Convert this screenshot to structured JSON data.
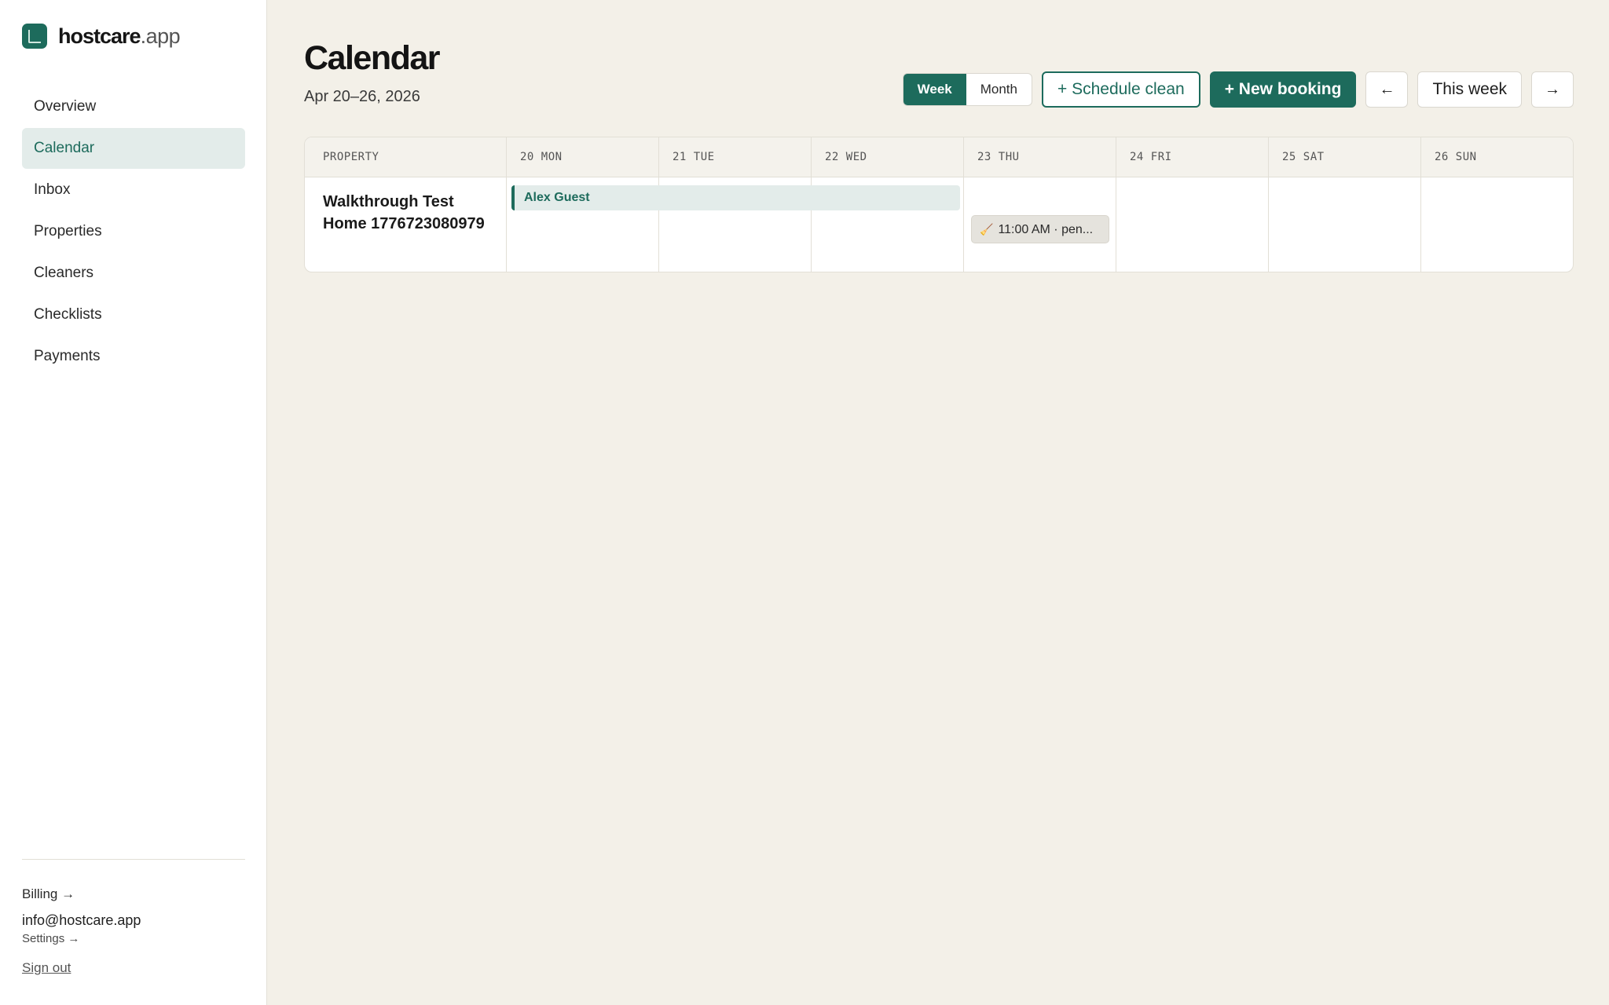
{
  "brand": {
    "name": "hostcare",
    "tld": ".app",
    "logo_icon": "app-logo-icon"
  },
  "nav": [
    {
      "label": "Overview",
      "active": false
    },
    {
      "label": "Calendar",
      "active": true
    },
    {
      "label": "Inbox",
      "active": false
    },
    {
      "label": "Properties",
      "active": false
    },
    {
      "label": "Cleaners",
      "active": false
    },
    {
      "label": "Checklists",
      "active": false
    },
    {
      "label": "Payments",
      "active": false
    }
  ],
  "footer": {
    "billing": "Billing →",
    "email": "info@hostcare.app",
    "settings": "Settings →",
    "signout": "Sign out"
  },
  "header": {
    "title": "Calendar",
    "date_range": "Apr 20–26, 2026"
  },
  "toolbar": {
    "views": [
      {
        "label": "Week",
        "active": true
      },
      {
        "label": "Month",
        "active": false
      }
    ],
    "schedule_clean": "+ Schedule clean",
    "new_booking": "+ New booking",
    "prev": "←",
    "this_week": "This week",
    "next": "→"
  },
  "calendar": {
    "property_header": "PROPERTY",
    "days": [
      "20 MON",
      "21 TUE",
      "22 WED",
      "23 THU",
      "24 FRI",
      "25 SAT",
      "26 SUN"
    ],
    "rows": [
      {
        "property": "Walkthrough Test Home 1776723080979",
        "booking": {
          "guest": "Alex Guest",
          "start_day": "20 MON",
          "end_day": "22 WED"
        },
        "clean": {
          "label": "11:00 AM · pen...",
          "day": "23 THU",
          "icon": "broom-icon"
        }
      }
    ]
  },
  "colors": {
    "accent": "#1d6b5c",
    "accent_light": "#e3ecea",
    "background": "#f3f0e8"
  }
}
